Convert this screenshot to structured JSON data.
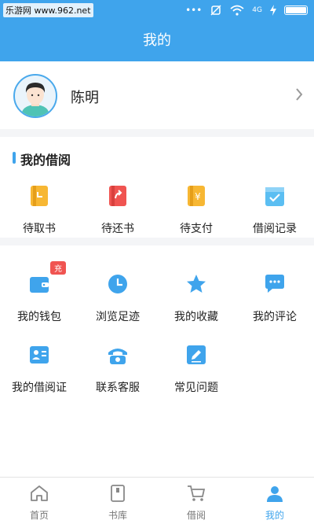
{
  "status_bar": {
    "watermark": "乐游网 www.962.net",
    "signal": "4G"
  },
  "header": {
    "title": "我的"
  },
  "profile": {
    "name": "陈明"
  },
  "borrow_section": {
    "title": "我的借阅",
    "items": [
      {
        "label": "待取书",
        "icon": "pickup-book-icon",
        "color": "#f7b733"
      },
      {
        "label": "待还书",
        "icon": "return-book-icon",
        "color": "#f05451"
      },
      {
        "label": "待支付",
        "icon": "payment-icon",
        "color": "#f7b733"
      },
      {
        "label": "借阅记录",
        "icon": "borrow-record-icon",
        "color": "#5bbef2"
      }
    ]
  },
  "services": {
    "items": [
      {
        "label": "我的钱包",
        "icon": "wallet-icon",
        "badge": "充"
      },
      {
        "label": "浏览足迹",
        "icon": "clock-icon"
      },
      {
        "label": "我的收藏",
        "icon": "star-icon"
      },
      {
        "label": "我的评论",
        "icon": "comment-icon"
      },
      {
        "label": "我的借阅证",
        "icon": "library-card-icon"
      },
      {
        "label": "联系客服",
        "icon": "phone-icon"
      },
      {
        "label": "常见问题",
        "icon": "edit-icon"
      }
    ]
  },
  "tabbar": {
    "items": [
      {
        "label": "首页",
        "icon": "home-icon"
      },
      {
        "label": "书库",
        "icon": "bookshelf-icon"
      },
      {
        "label": "借阅",
        "icon": "cart-icon"
      },
      {
        "label": "我的",
        "icon": "profile-icon"
      }
    ]
  },
  "colors": {
    "primary": "#3fa4ec",
    "accent_red": "#f05451",
    "accent_yellow": "#f7b733"
  }
}
